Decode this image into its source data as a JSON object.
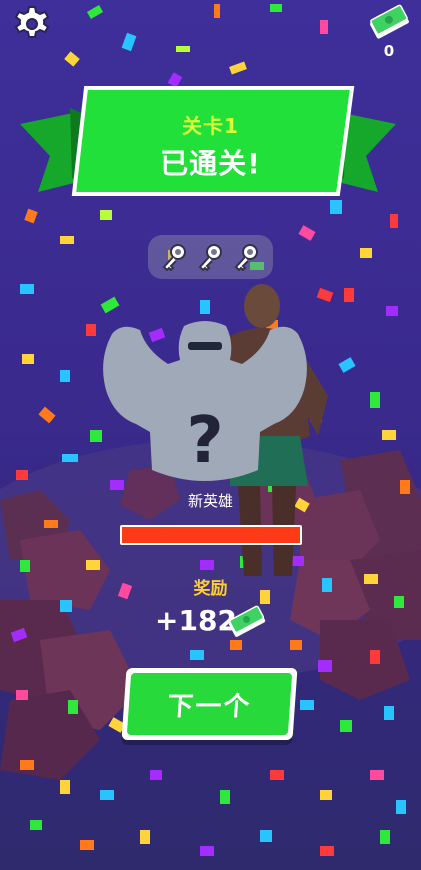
{
  "top_bar": {
    "settings_icon": "gear-icon",
    "cash_icon": "cash-stack-icon",
    "cash_count": "0"
  },
  "result_banner": {
    "level_label": "关卡1",
    "status_label": "已通关!"
  },
  "keys": {
    "collected": 0,
    "total": 3,
    "icon": "key-icon"
  },
  "hero": {
    "name_label": "新英雄",
    "unlock_progress": 1.0,
    "silhouette_icon": "mystery-bodybuilder-icon"
  },
  "reward": {
    "label": "奖励",
    "amount": "+182",
    "cash_icon": "cash-stack-icon"
  },
  "next_button": {
    "label": "下一个"
  },
  "colors": {
    "background_top": "#3e2f9a",
    "banner_green": "#22e03a",
    "banner_dark_green": "#15a82a",
    "level_yellow": "#d7ff3a",
    "reward_yellow": "#ffcf2e",
    "progress_red": "#ff3a16",
    "button_green": "#27d93a"
  }
}
